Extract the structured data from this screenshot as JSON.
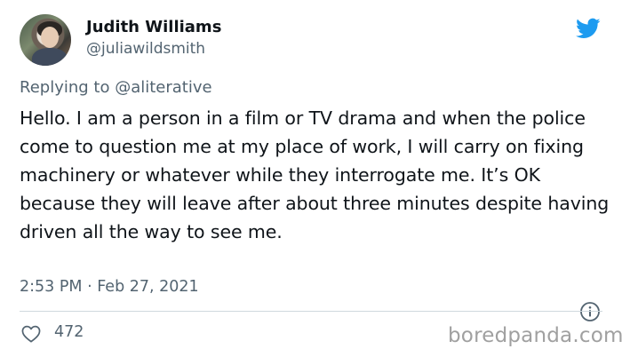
{
  "author": {
    "name": "Judith Williams",
    "handle": "@juliawildsmith"
  },
  "reply": {
    "text": "Replying to @aliterative"
  },
  "tweet": {
    "text": "Hello. I am a person in a film or TV drama and when the police come to question me at my place of work, I will carry on fixing machinery or whatever while they interrogate me. It’s OK because they will leave after about three minutes despite having driven all the way to see me.",
    "timestamp": "2:53 PM · Feb 27, 2021"
  },
  "engagement": {
    "likes": "472"
  },
  "watermark": {
    "text": "boredpanda.com"
  },
  "colors": {
    "brand_blue": "#1d9bf0",
    "secondary_text": "#536471",
    "primary_text": "#0f1419",
    "divider": "#cfd9de"
  },
  "icons": [
    "twitter-bird-icon",
    "info-icon",
    "heart-icon"
  ]
}
